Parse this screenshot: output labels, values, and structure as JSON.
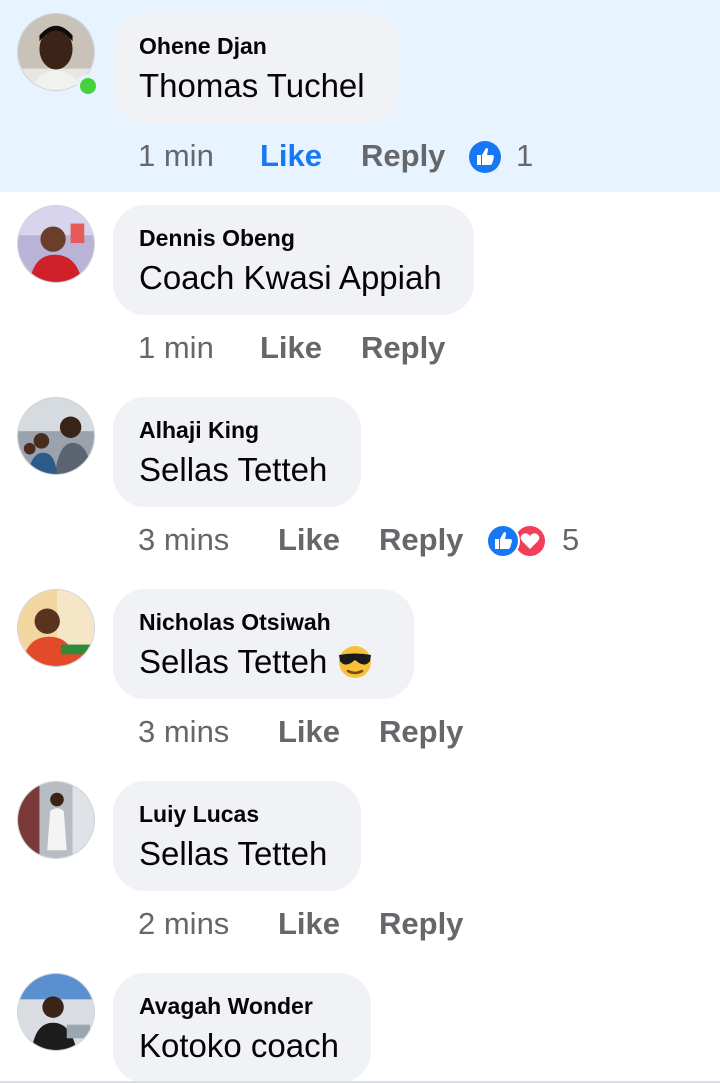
{
  "comments": [
    {
      "author": "Ohene Djan",
      "text": "Thomas Tuchel",
      "time": "1 min",
      "like": "Like",
      "reply": "Reply",
      "liked": true,
      "online": true,
      "reaction_count": "1",
      "reactions": [
        "like-icon"
      ]
    },
    {
      "author": "Dennis Obeng",
      "text": "Coach Kwasi Appiah",
      "time": "1 min",
      "like": "Like",
      "reply": "Reply"
    },
    {
      "author": "Alhaji King",
      "text": "Sellas Tetteh",
      "time": "3 mins",
      "like": "Like",
      "reply": "Reply",
      "reaction_count": "5",
      "reactions": [
        "like-icon",
        "love-icon"
      ]
    },
    {
      "author": "Nicholas Otsiwah",
      "text": "Sellas Tetteh",
      "time": "3 mins",
      "like": "Like",
      "reply": "Reply",
      "emoji": "sunglasses-emoji"
    },
    {
      "author": "Luiy Lucas",
      "text": "Sellas Tetteh",
      "time": "2 mins",
      "like": "Like",
      "reply": "Reply"
    },
    {
      "author": "Avagah Wonder",
      "text": "Kotoko coach"
    }
  ],
  "colors": {
    "highlight_bg": "#e7f3ff",
    "bubble_bg": "#f0f2f5",
    "like_blue": "#1877f2",
    "love_red": "#f33e58",
    "meta_gray": "#65676b",
    "online_green": "#44d13a"
  }
}
